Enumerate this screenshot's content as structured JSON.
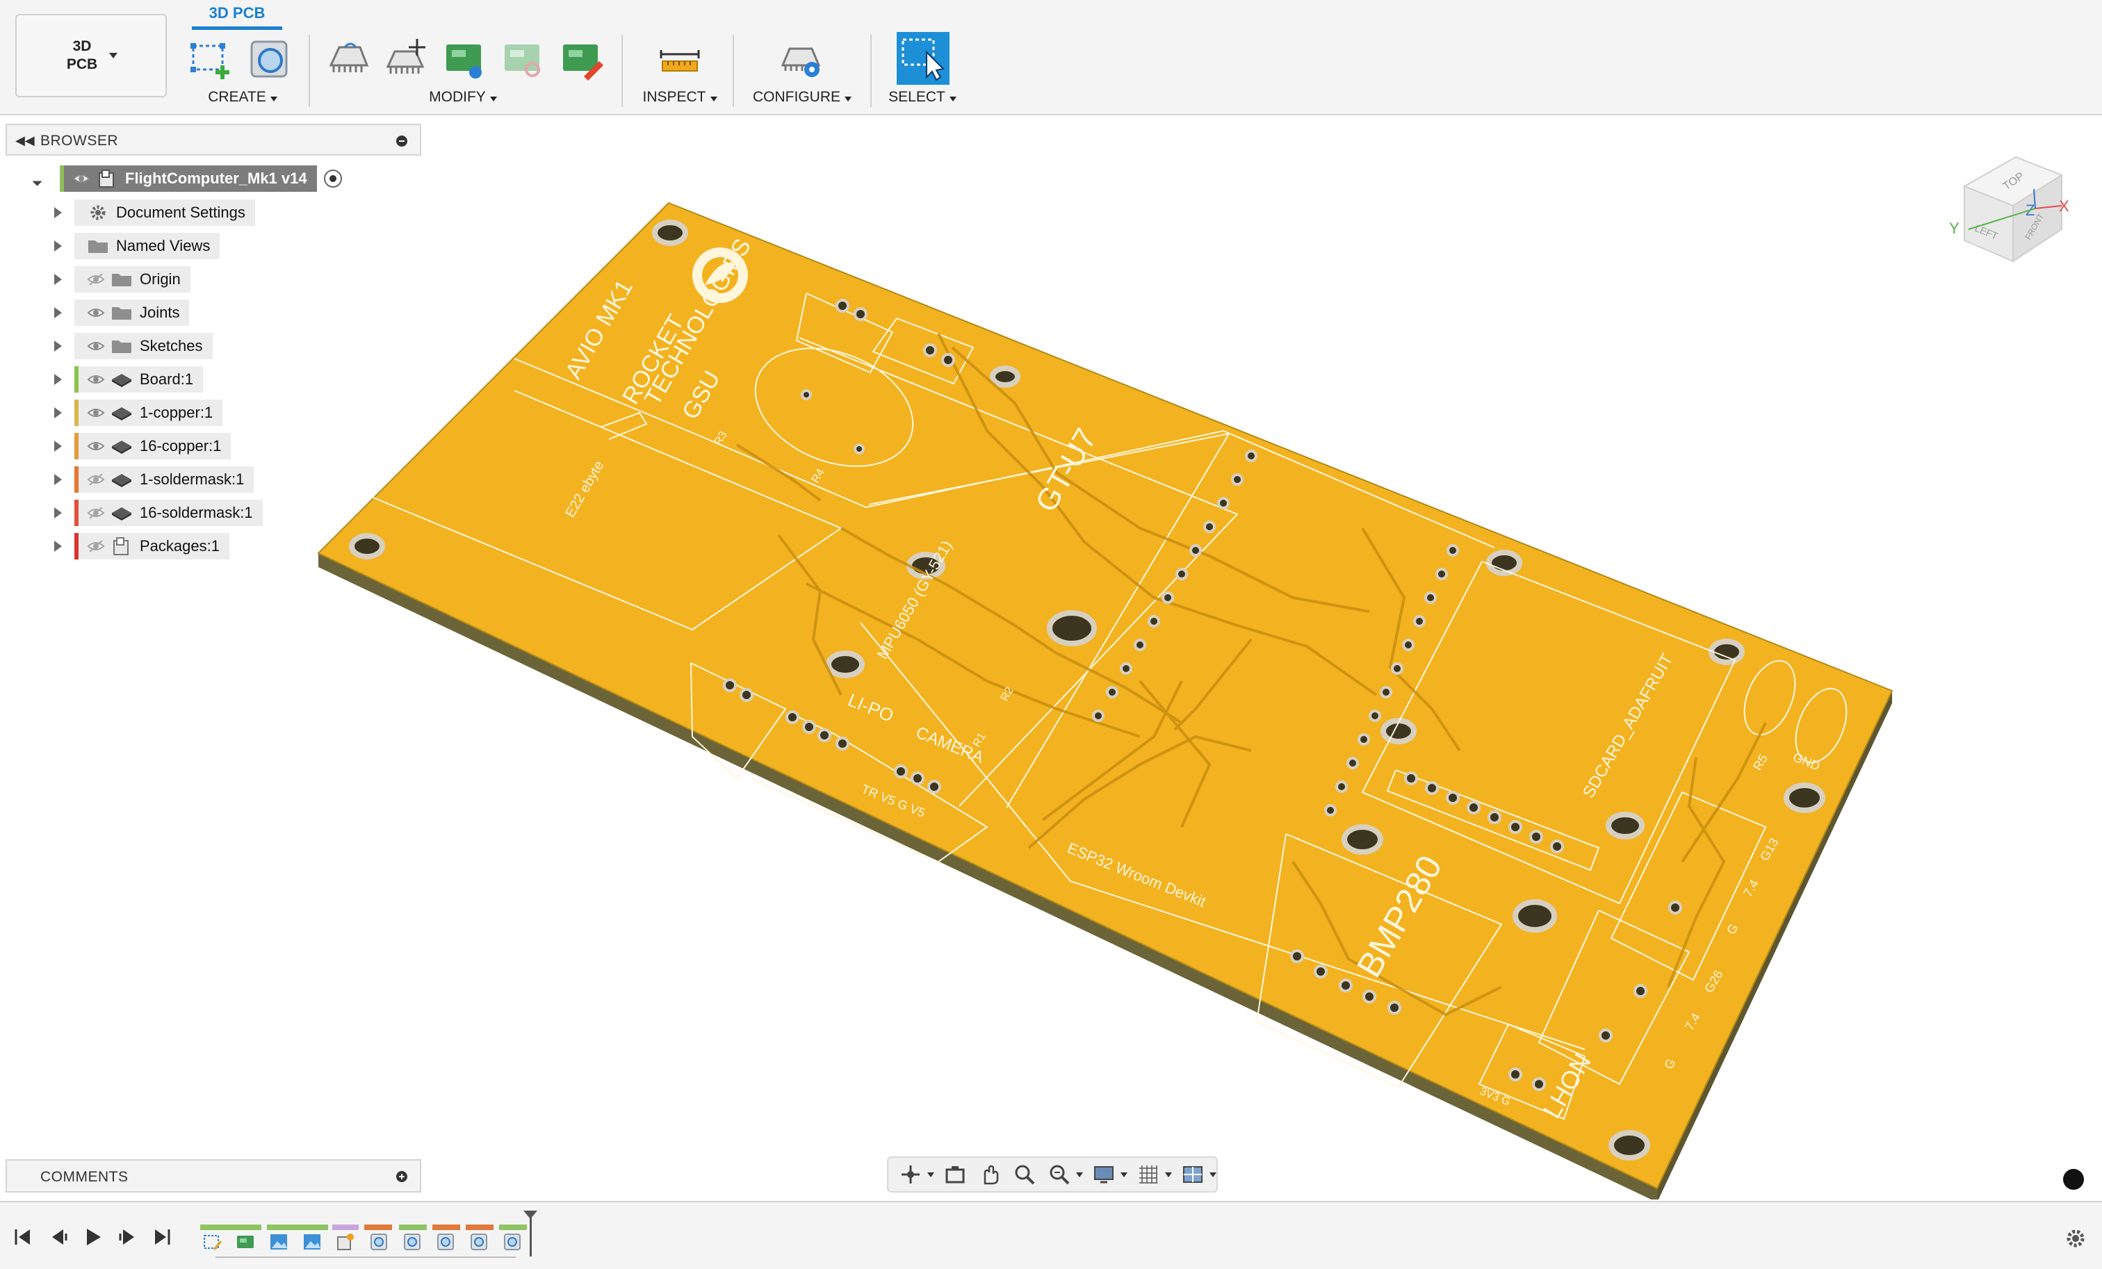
{
  "workspace": {
    "label": "3D PCB",
    "active_tab": "3D PCB"
  },
  "toolbar": {
    "groups": [
      {
        "label": "CREATE",
        "icons": [
          "sketch-rectangle-icon",
          "create-board-icon"
        ]
      },
      {
        "label": "MODIFY",
        "icons": [
          "chip-icon",
          "move-chip-icon",
          "push-board-icon",
          "link-board-icon",
          "edit-board-icon"
        ]
      },
      {
        "label": "INSPECT",
        "icons": [
          "measure-icon"
        ]
      },
      {
        "label": "CONFIGURE",
        "icons": [
          "configure-board-icon"
        ]
      },
      {
        "label": "SELECT",
        "icons": [
          "select-window-icon"
        ]
      }
    ]
  },
  "browser": {
    "title": "BROWSER",
    "root": {
      "label": "FlightComputer_Mk1 v14",
      "strip_color": "#8fbf5a"
    },
    "items": [
      {
        "label": "Document Settings",
        "kind": "settings",
        "eye": "none",
        "strip": ""
      },
      {
        "label": "Named Views",
        "kind": "folder",
        "eye": "none",
        "strip": ""
      },
      {
        "label": "Origin",
        "kind": "folder",
        "eye": "hidden",
        "strip": ""
      },
      {
        "label": "Joints",
        "kind": "folder",
        "eye": "visible",
        "strip": ""
      },
      {
        "label": "Sketches",
        "kind": "folder",
        "eye": "visible",
        "strip": ""
      },
      {
        "label": "Board:1",
        "kind": "body",
        "eye": "visible",
        "strip": "#8bc34a"
      },
      {
        "label": "1-copper:1",
        "kind": "body",
        "eye": "visible",
        "strip": "#d9b54a"
      },
      {
        "label": "16-copper:1",
        "kind": "body",
        "eye": "visible",
        "strip": "#e69a3c"
      },
      {
        "label": "1-soldermask:1",
        "kind": "body",
        "eye": "hidden",
        "strip": "#e8762e"
      },
      {
        "label": "16-soldermask:1",
        "kind": "body",
        "eye": "hidden",
        "strip": "#e0523a"
      },
      {
        "label": "Packages:1",
        "kind": "component",
        "eye": "hidden",
        "strip": "#d9342f"
      }
    ]
  },
  "comments": {
    "title": "COMMENTS"
  },
  "pcb": {
    "board_color": "#f3b220",
    "edge_color": "#6b6438",
    "silkscreen": {
      "title_line1": "AVIO MK1",
      "brand_line1": "ROCKET",
      "brand_line2": "TECHNOLOGIES",
      "brand_line3": "GSU",
      "gps": "GT-U7",
      "radio": "E22 ebyte",
      "imu": "MPU6050 (GY-521)",
      "battery": "LI-PO",
      "camera": "CAMERA",
      "mcu": "ESP32 Wroom Devkit",
      "baro": "BMP280",
      "sd": "SDCARD_ADAFRUIT",
      "lhon": "LHON",
      "pins_camera": "TR  V5  G  V5",
      "pins_right": "G13",
      "pin_74a": "7.4",
      "pin_g": "G",
      "pin_g26": "G26",
      "pin_74b": "7.4",
      "pin_g2": "G",
      "pin_gnd": "GND",
      "pin_r5": "R5",
      "pin_3v3": "3V3  G",
      "r3": "R3",
      "r4": "R4",
      "r1": "R1",
      "r2": "R2"
    }
  },
  "viewcube": {
    "top": "TOP",
    "left": "LEFT",
    "front": "FRONT",
    "axis_x": "X",
    "axis_y": "Y",
    "axis_z": "Z"
  },
  "navbar": {
    "buttons": [
      "orbit-icon",
      "look-at-icon",
      "pan-icon",
      "zoom-icon",
      "zoom-window-icon",
      "display-settings-icon",
      "grid-icon",
      "viewports-icon"
    ]
  },
  "timeline": {
    "settings_icon": "gear-icon"
  }
}
